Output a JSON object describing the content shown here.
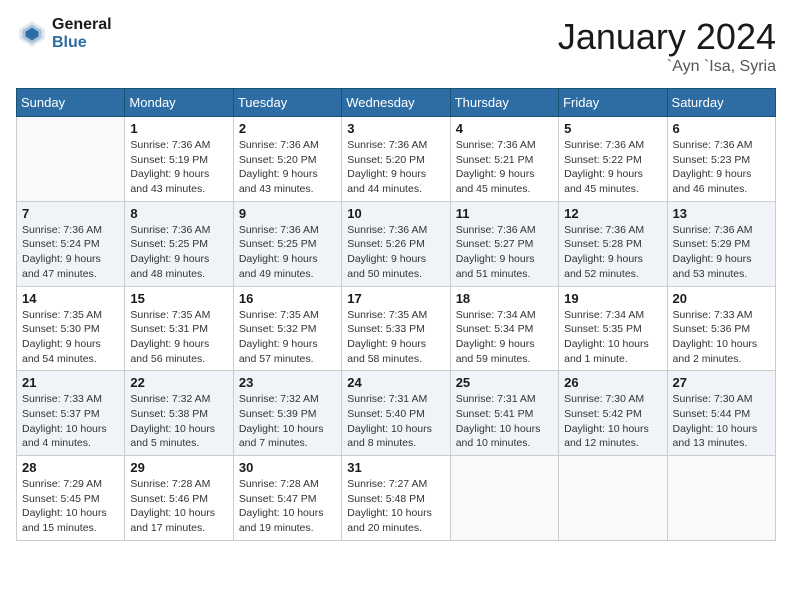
{
  "header": {
    "logo_line1": "General",
    "logo_line2": "Blue",
    "month": "January 2024",
    "location": "`Ayn `Isa, Syria"
  },
  "weekdays": [
    "Sunday",
    "Monday",
    "Tuesday",
    "Wednesday",
    "Thursday",
    "Friday",
    "Saturday"
  ],
  "weeks": [
    [
      {
        "day": "",
        "info": ""
      },
      {
        "day": "1",
        "info": "Sunrise: 7:36 AM\nSunset: 5:19 PM\nDaylight: 9 hours\nand 43 minutes."
      },
      {
        "day": "2",
        "info": "Sunrise: 7:36 AM\nSunset: 5:20 PM\nDaylight: 9 hours\nand 43 minutes."
      },
      {
        "day": "3",
        "info": "Sunrise: 7:36 AM\nSunset: 5:20 PM\nDaylight: 9 hours\nand 44 minutes."
      },
      {
        "day": "4",
        "info": "Sunrise: 7:36 AM\nSunset: 5:21 PM\nDaylight: 9 hours\nand 45 minutes."
      },
      {
        "day": "5",
        "info": "Sunrise: 7:36 AM\nSunset: 5:22 PM\nDaylight: 9 hours\nand 45 minutes."
      },
      {
        "day": "6",
        "info": "Sunrise: 7:36 AM\nSunset: 5:23 PM\nDaylight: 9 hours\nand 46 minutes."
      }
    ],
    [
      {
        "day": "7",
        "info": "Sunrise: 7:36 AM\nSunset: 5:24 PM\nDaylight: 9 hours\nand 47 minutes."
      },
      {
        "day": "8",
        "info": "Sunrise: 7:36 AM\nSunset: 5:25 PM\nDaylight: 9 hours\nand 48 minutes."
      },
      {
        "day": "9",
        "info": "Sunrise: 7:36 AM\nSunset: 5:25 PM\nDaylight: 9 hours\nand 49 minutes."
      },
      {
        "day": "10",
        "info": "Sunrise: 7:36 AM\nSunset: 5:26 PM\nDaylight: 9 hours\nand 50 minutes."
      },
      {
        "day": "11",
        "info": "Sunrise: 7:36 AM\nSunset: 5:27 PM\nDaylight: 9 hours\nand 51 minutes."
      },
      {
        "day": "12",
        "info": "Sunrise: 7:36 AM\nSunset: 5:28 PM\nDaylight: 9 hours\nand 52 minutes."
      },
      {
        "day": "13",
        "info": "Sunrise: 7:36 AM\nSunset: 5:29 PM\nDaylight: 9 hours\nand 53 minutes."
      }
    ],
    [
      {
        "day": "14",
        "info": "Sunrise: 7:35 AM\nSunset: 5:30 PM\nDaylight: 9 hours\nand 54 minutes."
      },
      {
        "day": "15",
        "info": "Sunrise: 7:35 AM\nSunset: 5:31 PM\nDaylight: 9 hours\nand 56 minutes."
      },
      {
        "day": "16",
        "info": "Sunrise: 7:35 AM\nSunset: 5:32 PM\nDaylight: 9 hours\nand 57 minutes."
      },
      {
        "day": "17",
        "info": "Sunrise: 7:35 AM\nSunset: 5:33 PM\nDaylight: 9 hours\nand 58 minutes."
      },
      {
        "day": "18",
        "info": "Sunrise: 7:34 AM\nSunset: 5:34 PM\nDaylight: 9 hours\nand 59 minutes."
      },
      {
        "day": "19",
        "info": "Sunrise: 7:34 AM\nSunset: 5:35 PM\nDaylight: 10 hours\nand 1 minute."
      },
      {
        "day": "20",
        "info": "Sunrise: 7:33 AM\nSunset: 5:36 PM\nDaylight: 10 hours\nand 2 minutes."
      }
    ],
    [
      {
        "day": "21",
        "info": "Sunrise: 7:33 AM\nSunset: 5:37 PM\nDaylight: 10 hours\nand 4 minutes."
      },
      {
        "day": "22",
        "info": "Sunrise: 7:32 AM\nSunset: 5:38 PM\nDaylight: 10 hours\nand 5 minutes."
      },
      {
        "day": "23",
        "info": "Sunrise: 7:32 AM\nSunset: 5:39 PM\nDaylight: 10 hours\nand 7 minutes."
      },
      {
        "day": "24",
        "info": "Sunrise: 7:31 AM\nSunset: 5:40 PM\nDaylight: 10 hours\nand 8 minutes."
      },
      {
        "day": "25",
        "info": "Sunrise: 7:31 AM\nSunset: 5:41 PM\nDaylight: 10 hours\nand 10 minutes."
      },
      {
        "day": "26",
        "info": "Sunrise: 7:30 AM\nSunset: 5:42 PM\nDaylight: 10 hours\nand 12 minutes."
      },
      {
        "day": "27",
        "info": "Sunrise: 7:30 AM\nSunset: 5:44 PM\nDaylight: 10 hours\nand 13 minutes."
      }
    ],
    [
      {
        "day": "28",
        "info": "Sunrise: 7:29 AM\nSunset: 5:45 PM\nDaylight: 10 hours\nand 15 minutes."
      },
      {
        "day": "29",
        "info": "Sunrise: 7:28 AM\nSunset: 5:46 PM\nDaylight: 10 hours\nand 17 minutes."
      },
      {
        "day": "30",
        "info": "Sunrise: 7:28 AM\nSunset: 5:47 PM\nDaylight: 10 hours\nand 19 minutes."
      },
      {
        "day": "31",
        "info": "Sunrise: 7:27 AM\nSunset: 5:48 PM\nDaylight: 10 hours\nand 20 minutes."
      },
      {
        "day": "",
        "info": ""
      },
      {
        "day": "",
        "info": ""
      },
      {
        "day": "",
        "info": ""
      }
    ]
  ]
}
